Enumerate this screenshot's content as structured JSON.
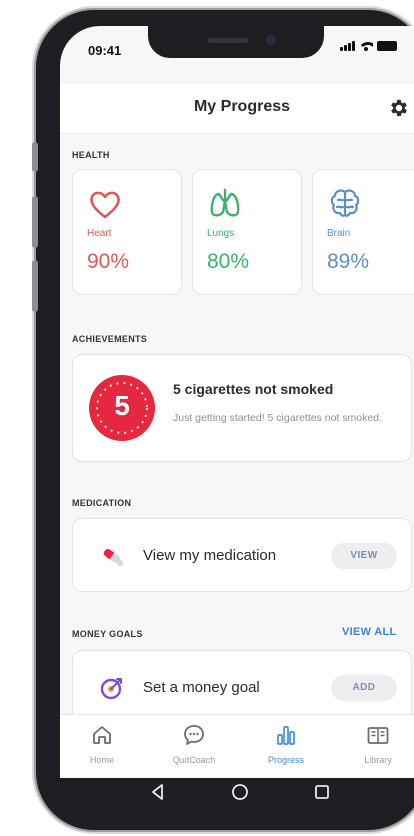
{
  "status_bar": {
    "time": "09:41"
  },
  "header": {
    "title": "My Progress",
    "settings_icon": "gear-icon"
  },
  "health": {
    "label": "HEALTH",
    "cards": [
      {
        "name": "Heart",
        "value": "90%",
        "color": "#d95a5a",
        "icon": "heart-icon"
      },
      {
        "name": "Lungs",
        "value": "80%",
        "color": "#3fb06e",
        "icon": "lungs-icon"
      },
      {
        "name": "Brain",
        "value": "89%",
        "color": "#5b8fc7",
        "icon": "brain-icon"
      }
    ]
  },
  "achievements": {
    "label": "ACHIEVEMENTS",
    "badge_number": "5",
    "badge_color": "#e5283f",
    "title": "5 cigarettes not smoked",
    "description": "Just getting started! 5 cigarettes not smoked."
  },
  "medication": {
    "label": "MEDICATION",
    "row_label": "View my medication",
    "action": "VIEW",
    "icon": "pill-icon"
  },
  "money_goals": {
    "label": "MONEY GOALS",
    "view_all": "VIEW ALL",
    "row_label": "Set a money goal",
    "action": "ADD",
    "icon": "target-icon"
  },
  "tabs": [
    {
      "label": "Home",
      "icon": "home-icon",
      "active": false
    },
    {
      "label": "QuitCoach",
      "icon": "chat-bubble-icon",
      "active": false
    },
    {
      "label": "Progress",
      "icon": "bar-chart-icon",
      "active": true
    },
    {
      "label": "Library",
      "icon": "book-icon",
      "active": false
    }
  ],
  "colors": {
    "accent": "#3f8fd8",
    "link": "#3a86c8"
  }
}
